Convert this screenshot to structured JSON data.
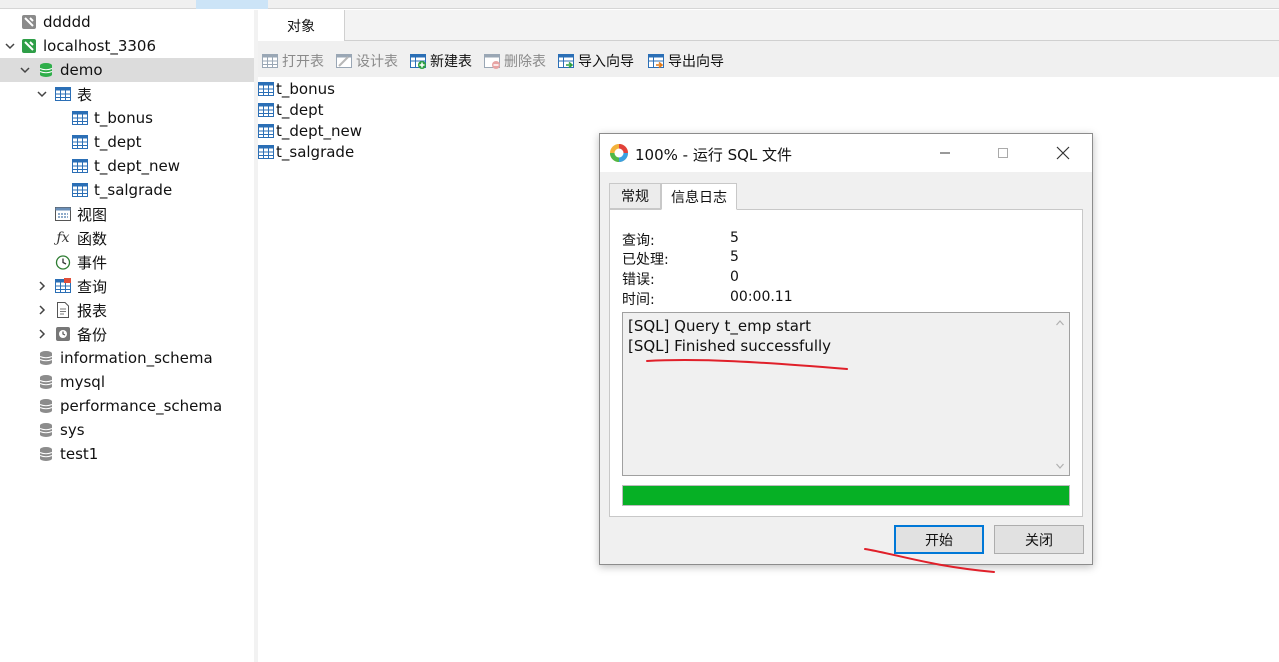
{
  "navigator": {
    "items": [
      {
        "label": "ddddd",
        "icon": "connection-icon"
      },
      {
        "label": "localhost_3306",
        "icon": "connection-icon"
      },
      {
        "label": "demo",
        "icon": "database-icon"
      },
      {
        "label": "表",
        "icon": "table-folder-icon"
      },
      {
        "label": "t_bonus",
        "icon": "table-icon"
      },
      {
        "label": "t_dept",
        "icon": "table-icon"
      },
      {
        "label": "t_dept_new",
        "icon": "table-icon"
      },
      {
        "label": "t_salgrade",
        "icon": "table-icon"
      },
      {
        "label": "视图",
        "icon": "view-icon"
      },
      {
        "label": "函数",
        "icon": "function-icon"
      },
      {
        "label": "事件",
        "icon": "event-clock-icon"
      },
      {
        "label": "查询",
        "icon": "query-icon"
      },
      {
        "label": "报表",
        "icon": "report-icon"
      },
      {
        "label": "备份",
        "icon": "backup-icon"
      },
      {
        "label": "information_schema",
        "icon": "database-icon"
      },
      {
        "label": "mysql",
        "icon": "database-icon"
      },
      {
        "label": "performance_schema",
        "icon": "database-icon"
      },
      {
        "label": "sys",
        "icon": "database-icon"
      },
      {
        "label": "test1",
        "icon": "database-icon"
      }
    ]
  },
  "main": {
    "tab_label": "对象",
    "toolbar": {
      "open_table": "打开表",
      "design_table": "设计表",
      "new_table": "新建表",
      "delete_table": "删除表",
      "import_wizard": "导入向导",
      "export_wizard": "导出向导"
    },
    "objects": [
      "t_bonus",
      "t_dept",
      "t_dept_new",
      "t_salgrade"
    ]
  },
  "dialog": {
    "title": "100% - 运行 SQL 文件",
    "tabs": [
      "常规",
      "信息日志"
    ],
    "active_tab": "信息日志",
    "stats": [
      {
        "label": "查询:",
        "value": "5"
      },
      {
        "label": "已处理:",
        "value": "5"
      },
      {
        "label": "错误:",
        "value": "0"
      },
      {
        "label": "时间:",
        "value": "00:00.11"
      }
    ],
    "log_lines": [
      "[SQL] Query t_emp start",
      "[SQL] Finished successfully"
    ],
    "progress_percent": 100,
    "start_button": "开始",
    "close_button": "关闭"
  },
  "colors": {
    "progress": "#06b025",
    "selection": "#dcdcdc",
    "annotation": "#e0202a",
    "connection_green": "#2e9e47",
    "focus_blue": "#0078d7"
  }
}
